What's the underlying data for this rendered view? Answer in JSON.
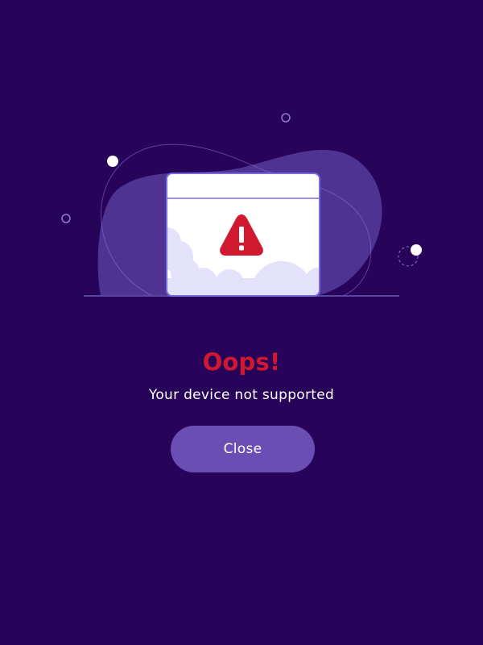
{
  "dialog": {
    "title": "Oops!",
    "message": "Your device not supported",
    "close_label": "Close"
  },
  "colors": {
    "background": "#28035a",
    "blob": "#4f3393",
    "title": "#d0182f",
    "button": "#6a4eb3",
    "warning": "#d0182f",
    "cloud": "#e4e2fb",
    "window_border": "#7a6ae0"
  },
  "icons": {
    "illustration": "browser-window-warning-illustration",
    "warning": "warning-triangle-icon"
  }
}
